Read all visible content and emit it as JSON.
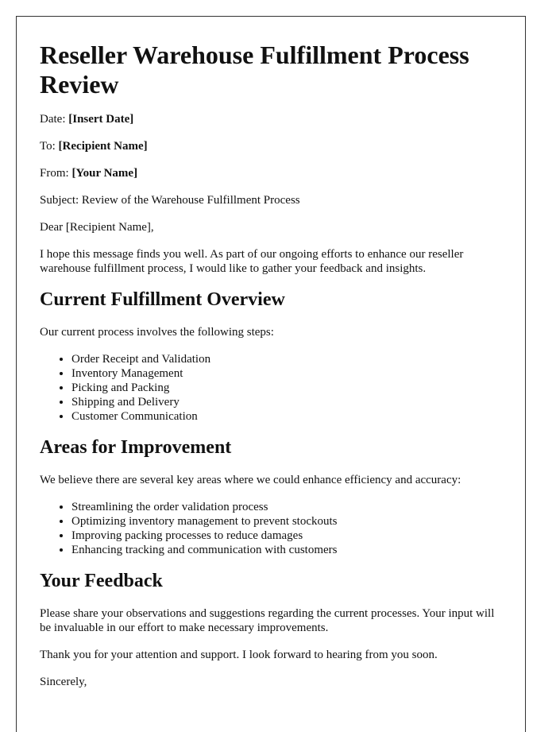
{
  "document": {
    "title": "Reseller Warehouse Fulfillment Process Review",
    "header_fields": [
      {
        "label": "Date: ",
        "value": "[Insert Date]"
      },
      {
        "label": "To: ",
        "value": "[Recipient Name]"
      },
      {
        "label": "From: ",
        "value": "[Your Name]"
      }
    ],
    "subject": "Subject: Review of the Warehouse Fulfillment Process",
    "greeting": "Dear [Recipient Name],",
    "intro": "I hope this message finds you well. As part of our ongoing efforts to enhance our reseller warehouse fulfillment process, I would like to gather your feedback and insights.",
    "sections": [
      {
        "heading": "Current Fulfillment Overview",
        "lead": "Our current process involves the following steps:",
        "items": [
          "Order Receipt and Validation",
          "Inventory Management",
          "Picking and Packing",
          "Shipping and Delivery",
          "Customer Communication"
        ]
      },
      {
        "heading": "Areas for Improvement",
        "lead": "We believe there are several key areas where we could enhance efficiency and accuracy:",
        "items": [
          "Streamlining the order validation process",
          "Optimizing inventory management to prevent stockouts",
          "Improving packing processes to reduce damages",
          "Enhancing tracking and communication with customers"
        ]
      },
      {
        "heading": "Your Feedback",
        "lead": "Please share your observations and suggestions regarding the current processes. Your input will be invaluable in our effort to make necessary improvements."
      }
    ],
    "closing_paragraph": "Thank you for your attention and support. I look forward to hearing from you soon.",
    "sign_off": "Sincerely,"
  }
}
